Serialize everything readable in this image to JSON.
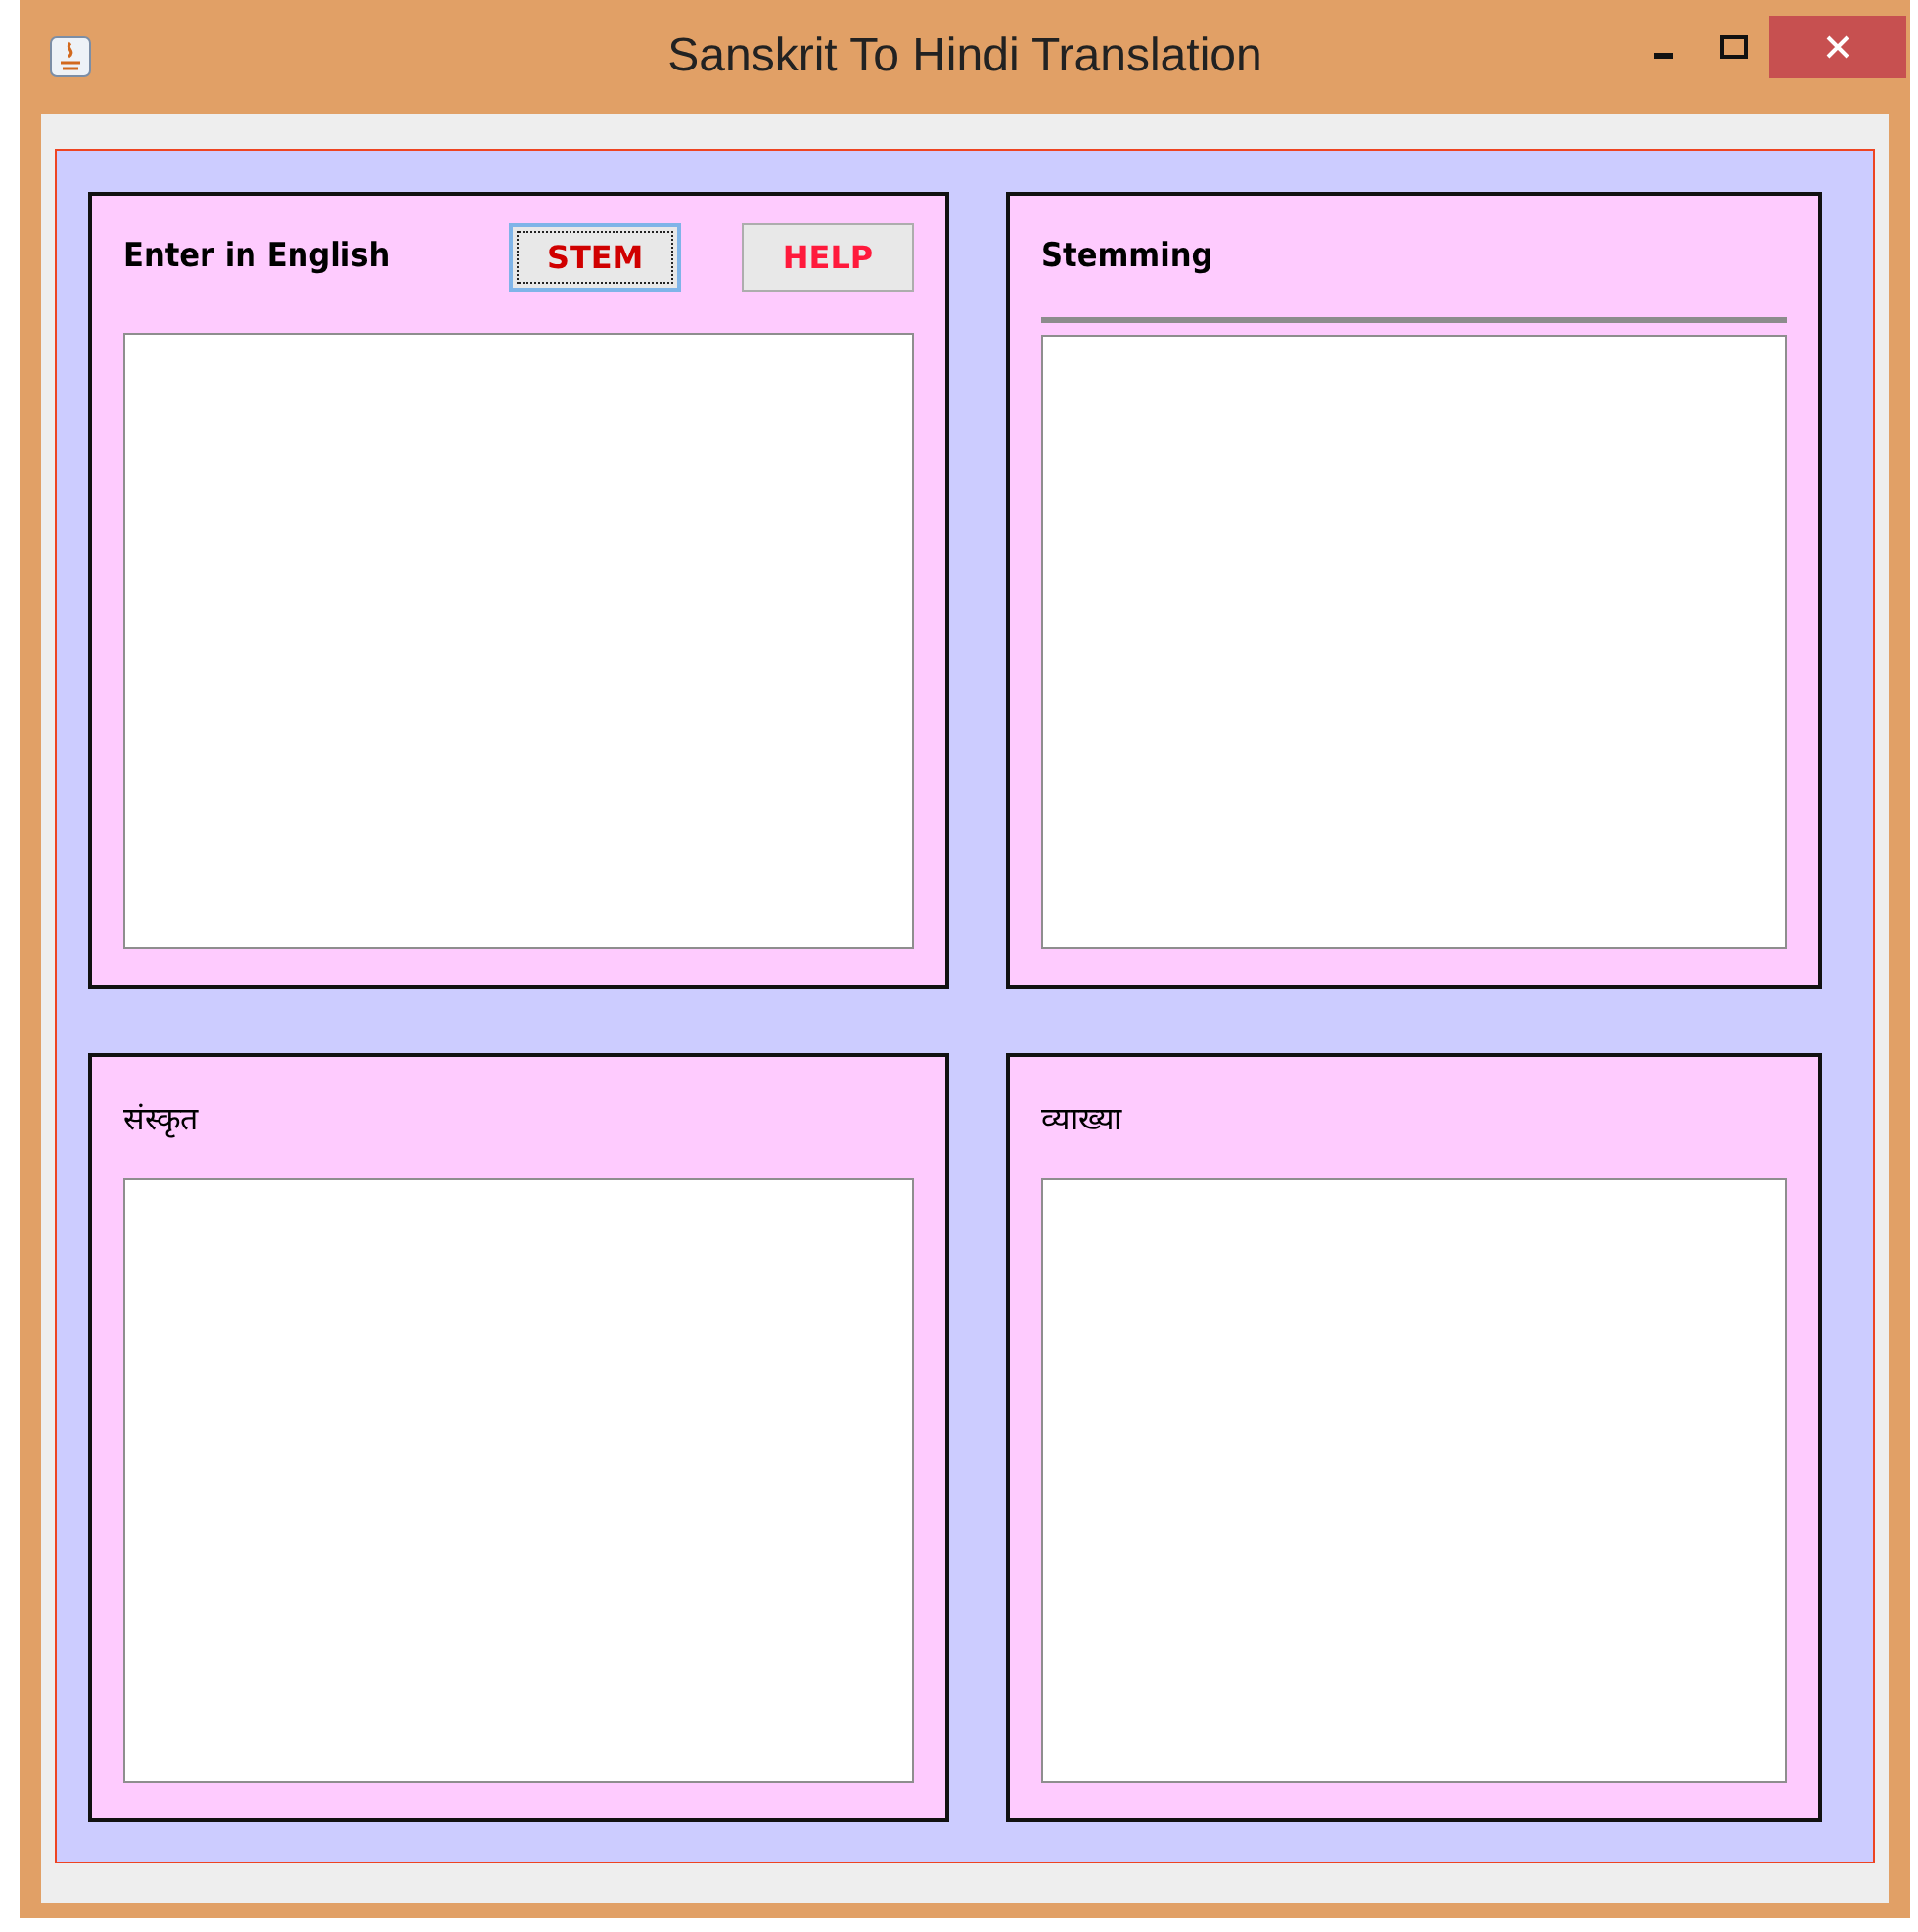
{
  "window": {
    "title": "Sanskrit To Hindi Translation"
  },
  "panels": [
    {
      "label": "Enter in English",
      "kind": "buttons",
      "buttons": [
        {
          "label": "STEM",
          "focused": true
        },
        {
          "label": "HELP",
          "focused": false
        }
      ]
    },
    {
      "label": "Stemming",
      "kind": "separator"
    },
    {
      "label": "संस्कृत",
      "kind": "plain"
    },
    {
      "label": "व्याख्या",
      "kind": "plain"
    }
  ]
}
